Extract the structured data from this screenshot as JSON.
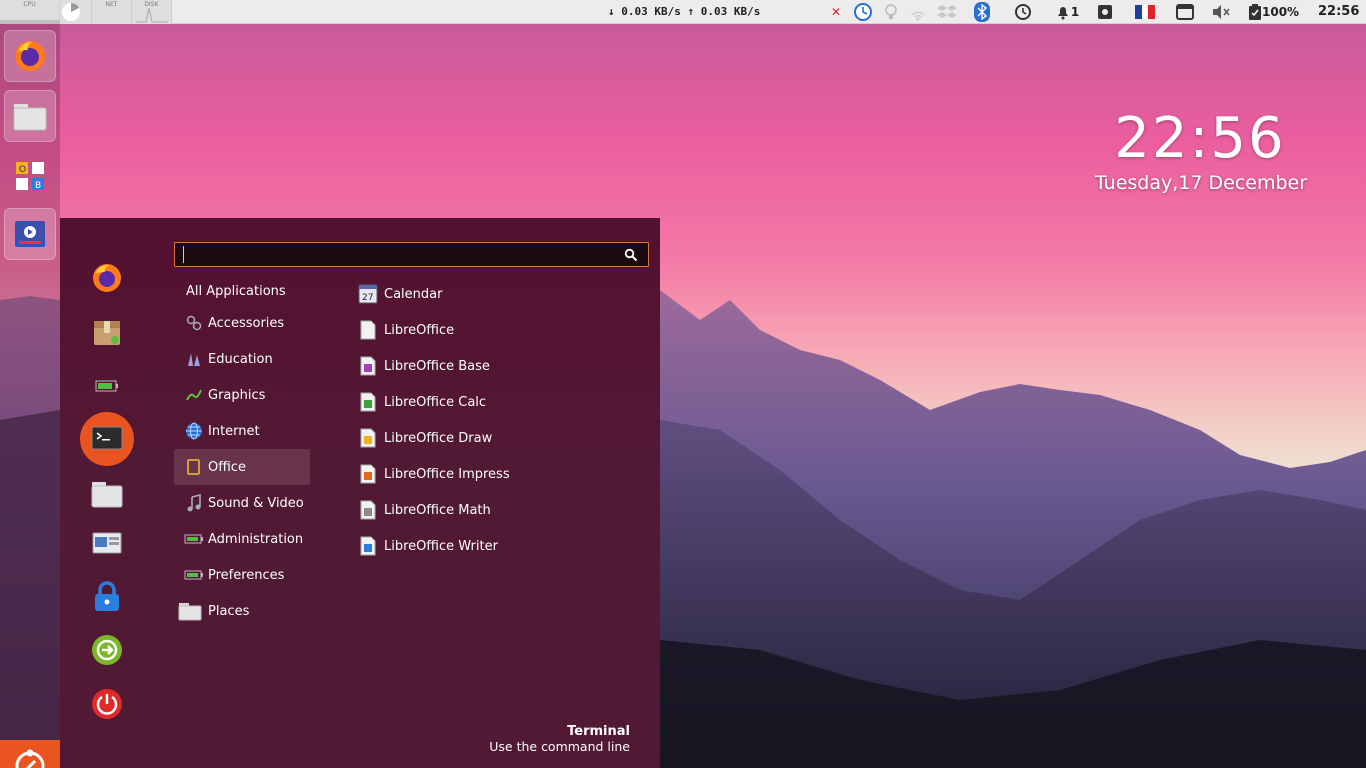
{
  "top_panel": {
    "graphs": [
      {
        "label": "CPU"
      },
      {
        "label": ""
      },
      {
        "label": "NET"
      },
      {
        "label": "DISK"
      }
    ],
    "net_speed": "↓ 0.03 KB/s ↑ 0.03 KB/s",
    "notifications_count": "1",
    "battery": "100%",
    "clock": "22:56"
  },
  "desktop": {
    "time": "22:56",
    "date": "Tuesday,17 December"
  },
  "menu": {
    "search": {
      "value": "",
      "placeholder": ""
    },
    "categories": [
      {
        "label": "All Applications",
        "icon": "none"
      },
      {
        "label": "Accessories",
        "icon": "accessories-icon"
      },
      {
        "label": "Education",
        "icon": "education-icon"
      },
      {
        "label": "Graphics",
        "icon": "graphics-icon"
      },
      {
        "label": "Internet",
        "icon": "globe-icon"
      },
      {
        "label": "Office",
        "icon": "office-icon"
      },
      {
        "label": "Sound & Video",
        "icon": "music-note-icon"
      },
      {
        "label": "Administration",
        "icon": "battery-icon"
      },
      {
        "label": "Preferences",
        "icon": "battery-icon"
      },
      {
        "label": "Places",
        "icon": "folder-icon"
      }
    ],
    "selected_category": "Office",
    "apps": [
      {
        "label": "Calendar",
        "icon": "calendar-icon"
      },
      {
        "label": "LibreOffice",
        "icon": "libreoffice-icon"
      },
      {
        "label": "LibreOffice Base",
        "icon": "libreoffice-base-icon"
      },
      {
        "label": "LibreOffice Calc",
        "icon": "libreoffice-calc-icon"
      },
      {
        "label": "LibreOffice Draw",
        "icon": "libreoffice-draw-icon"
      },
      {
        "label": "LibreOffice Impress",
        "icon": "libreoffice-impress-icon"
      },
      {
        "label": "LibreOffice Math",
        "icon": "libreoffice-math-icon"
      },
      {
        "label": "LibreOffice Writer",
        "icon": "libreoffice-writer-icon"
      }
    ],
    "calendar_day": "27",
    "description": {
      "title": "Terminal",
      "subtitle": "Use the command line"
    }
  },
  "colors": {
    "accent": "#e95420",
    "menu_bg": "#460a28",
    "panel_bg": "#ececec"
  }
}
